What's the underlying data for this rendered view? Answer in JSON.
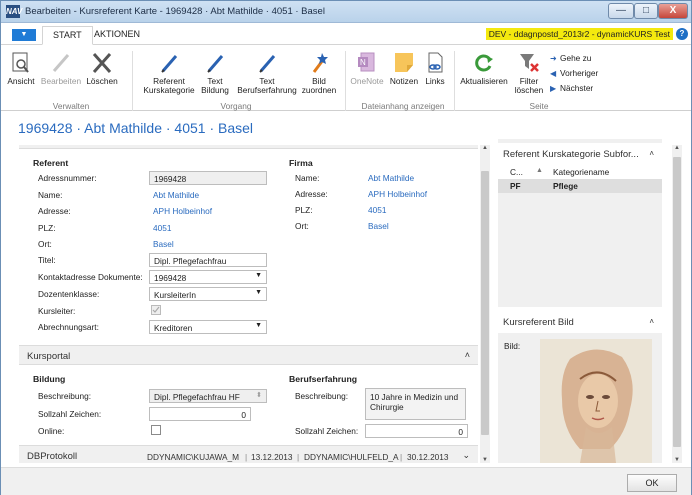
{
  "window": {
    "title": "Bearbeiten - Kursreferent Karte - 1969428 · Abt Mathilde · 4051 · Basel",
    "app_icon": "NAV",
    "min": "—",
    "max": "□",
    "close": "X"
  },
  "tabs": {
    "start": "START",
    "aktionen": "AKTIONEN",
    "env": "DEV - ddagnpostd_2013r2 - dynamicKURS Test",
    "help": "?"
  },
  "ribbon": {
    "ansicht": "Ansicht",
    "bearbeiten": "Bearbeiten",
    "loeschen": "Löschen",
    "grp_verwalten": "Verwalten",
    "ref_kat_1": "Referent",
    "ref_kat_2": "Kurskategorie",
    "text_bildung_1": "Text",
    "text_bildung_2": "Bildung",
    "text_beruf_1": "Text",
    "text_beruf_2": "Berufserfahrung",
    "bild_1": "Bild",
    "bild_2": "zuordnen",
    "grp_vorgang": "Vorgang",
    "onenote": "OneNote",
    "notizen": "Notizen",
    "links": "Links",
    "grp_dateianhang": "Dateianhang anzeigen",
    "aktualisieren": "Aktualisieren",
    "filter_1": "Filter",
    "filter_2": "löschen",
    "gehe_zu": "Gehe zu",
    "vorheriger": "Vorheriger",
    "naechster": "Nächster",
    "grp_seite": "Seite"
  },
  "page": {
    "title": "1969428 · Abt Mathilde · 4051 · Basel"
  },
  "referent": {
    "heading": "Referent",
    "adressnummer_label": "Adressnummer:",
    "adressnummer": "1969428",
    "name_label": "Name:",
    "name": "Abt Mathilde",
    "adresse_label": "Adresse:",
    "adresse": "APH Holbeinhof",
    "plz_label": "PLZ:",
    "plz": "4051",
    "ort_label": "Ort:",
    "ort": "Basel",
    "titel_label": "Titel:",
    "titel": "Dipl. Pflegefachfrau",
    "kontakt_label": "Kontaktadresse Dokumente:",
    "kontakt": "1969428",
    "dozent_label": "Dozentenklasse:",
    "dozent": "KursleiterIn",
    "kursleiter_label": "Kursleiter:",
    "abrechnung_label": "Abrechnungsart:",
    "abrechnung": "Kreditoren"
  },
  "firma": {
    "heading": "Firma",
    "name_label": "Name:",
    "name": "Abt Mathilde",
    "adresse_label": "Adresse:",
    "adresse": "APH Holbeinhof",
    "plz_label": "PLZ:",
    "plz": "4051",
    "ort_label": "Ort:",
    "ort": "Basel"
  },
  "kursportal": {
    "heading": "Kursportal",
    "chevron": "˄",
    "bildung_heading": "Bildung",
    "beschreibung_label": "Beschreibung:",
    "beschreibung": "Dipl. Pflegefachfrau HF",
    "sollzahl_label": "Sollzahl Zeichen:",
    "sollzahl": "0",
    "online_label": "Online:",
    "beruf_heading": "Berufserfahrung",
    "beruf_beschreibung_label": "Beschreibung:",
    "beruf_beschreibung": "10 Jahre in Medizin und Chirurgie",
    "beruf_sollzahl_label": "Sollzahl Zeichen:",
    "beruf_sollzahl": "0"
  },
  "dbprotokoll": {
    "heading": "DBProtokoll",
    "user1": "DDYNAMIC\\KUJAWA_M",
    "date1": "13.12.2013",
    "user2": "DDYNAMIC\\HULFELD_A",
    "date2": "30.12.2013"
  },
  "factbox_kat": {
    "title": "Referent Kurskategorie Subfor...",
    "chevron": "˄",
    "col1": "C...",
    "col2": "Kategoriename",
    "row_code": "PF",
    "row_name": "Pflege"
  },
  "factbox_bild": {
    "title": "Kursreferent Bild",
    "chevron": "˄",
    "label": "Bild:"
  },
  "footer": {
    "ok": "OK"
  }
}
